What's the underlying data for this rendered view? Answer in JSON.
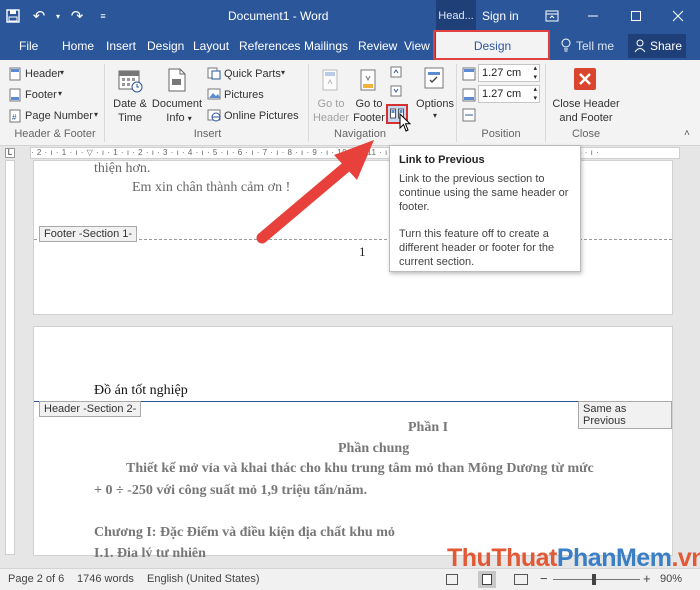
{
  "title_bar": {
    "doc_title": "Document1 - Word",
    "context_tab": "Head...",
    "sign_in": "Sign in"
  },
  "tabs": {
    "file": "File",
    "home": "Home",
    "insert": "Insert",
    "design": "Design",
    "layout": "Layout",
    "references": "References",
    "mailings": "Mailings",
    "review": "Review",
    "view": "View",
    "context_design": "Design",
    "tell_me": "Tell me",
    "share": "Share"
  },
  "ribbon": {
    "header": "Header",
    "footer": "Footer",
    "page_number": "Page Number",
    "hf_group": "Header & Footer",
    "date_time": [
      "Date &",
      "Time"
    ],
    "document_info": [
      "Document",
      "Info"
    ],
    "quick_parts": "Quick Parts",
    "pictures": "Pictures",
    "online_pictures": "Online Pictures",
    "insert_group": "Insert",
    "go_to_header": [
      "Go to",
      "Header"
    ],
    "go_to_footer": [
      "Go to",
      "Footer"
    ],
    "navigation_group": "Navigation",
    "options": "Options",
    "spin_top": "1.27 cm",
    "spin_bottom": "1.27 cm",
    "position_group": "Position",
    "close_hf": [
      "Close Header",
      "and Footer"
    ],
    "close_group": "Close"
  },
  "ruler": {
    "labels": "· 2 · ı · 1 · ı · ▽ · ı · 1 · ı · 2 · ı · 3 · ı · 4 · ı · 5 · ı · 6 · ı · 7 · ı · 8 · ı · 9 · ı · 10 · ı · 11 · ı · 12 · ı · 13 · ı · 14 · ı · 15 · ı · △ · ı · 17 · ı · 18 · ı ·"
  },
  "page1": {
    "line1": "thiện hơn.",
    "line2": "Em xin chân thành cảm ơn !",
    "footer_tag": "Footer -Section 1-",
    "page_number": "1"
  },
  "page2": {
    "header_text": "Đồ án tốt nghiệp",
    "header_tag": "Header -Section 2-",
    "same_as_previous": "Same as Previous",
    "phan": "Phần I",
    "phan_chung": "Phần chung",
    "para1": "Thiết kế mở vỉa và khai thác cho khu trung tâm mỏ than Mông Dương từ mức",
    "para2": "+ 0 ÷ -250 với công suất mỏ 1,9 triệu tấn/năm.",
    "chuong": "Chương I: Đặc Điểm và điều kiện địa chất khu mỏ",
    "sub": "I.1. Địa lý tự nhiên"
  },
  "tooltip": {
    "title": "Link to Previous",
    "p1": "Link to the previous section to continue using the same header or footer.",
    "p2": "Turn this feature off to create a different header or footer for the current section."
  },
  "status": {
    "page": "Page 2 of 6",
    "words": "1746 words",
    "language": "English (United States)",
    "zoom": "90%"
  },
  "watermark": {
    "part1": "ThuThuat",
    "part2": "PhanMem",
    "part3": ".vn"
  },
  "colors": {
    "word_blue": "#2b579a",
    "highlight_red": "#e04040",
    "arrow_red": "#e8403a",
    "close_red": "#d9452e"
  }
}
